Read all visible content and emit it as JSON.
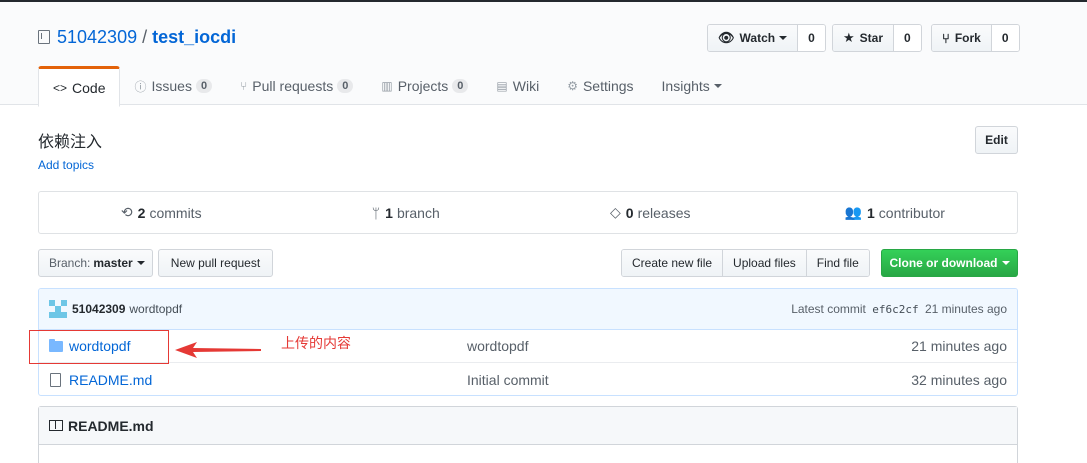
{
  "repo": {
    "owner": "51042309",
    "separator": "/",
    "name": "test_iocdi"
  },
  "actions": {
    "watch": {
      "label": "Watch",
      "count": "0"
    },
    "star": {
      "label": "Star",
      "count": "0"
    },
    "fork": {
      "label": "Fork",
      "count": "0"
    }
  },
  "tabs": [
    {
      "label": "Code",
      "icon": "code-icon"
    },
    {
      "label": "Issues",
      "counter": "0",
      "icon": "issue-icon"
    },
    {
      "label": "Pull requests",
      "counter": "0",
      "icon": "pull-request-icon"
    },
    {
      "label": "Projects",
      "counter": "0",
      "icon": "project-icon"
    },
    {
      "label": "Wiki",
      "icon": "book-icon"
    },
    {
      "label": "Settings",
      "icon": "gear-icon"
    },
    {
      "label": "Insights",
      "icon": "none"
    }
  ],
  "description": "依赖注入",
  "add_topics": "Add topics",
  "edit_label": "Edit",
  "summary": {
    "commits": {
      "num": "2",
      "label": "commits"
    },
    "branches": {
      "num": "1",
      "label": "branch"
    },
    "releases": {
      "num": "0",
      "label": "releases"
    },
    "contributors": {
      "num": "1",
      "label": "contributor"
    }
  },
  "branch": {
    "prefix": "Branch:",
    "name": "master"
  },
  "new_pr_label": "New pull request",
  "file_buttons": {
    "create": "Create new file",
    "upload": "Upload files",
    "find": "Find file"
  },
  "clone_label": "Clone or download",
  "commit_tease": {
    "author": "51042309",
    "message": "wordtopdf",
    "latest_prefix": "Latest commit",
    "sha": "ef6c2cf",
    "age": "21 minutes ago"
  },
  "files": [
    {
      "type": "dir",
      "name": "wordtopdf",
      "message": "wordtopdf",
      "age": "21 minutes ago"
    },
    {
      "type": "file",
      "name": "README.md",
      "message": "Initial commit",
      "age": "32 minutes ago"
    }
  ],
  "readme": {
    "title": "README.md"
  },
  "annotation": {
    "text": "上传的内容",
    "color": "#e53935"
  },
  "colors": {
    "link": "#0366d6",
    "accent_tab": "#e36209",
    "clone_green": "#28a745"
  }
}
